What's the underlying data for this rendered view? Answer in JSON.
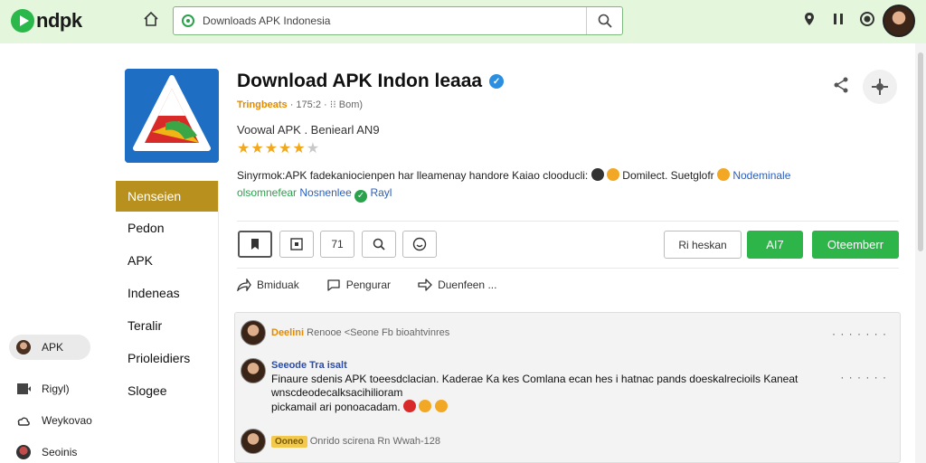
{
  "header": {
    "logo_text": "ndpk",
    "search_value": "Downloads APK Indonesia",
    "icons": [
      "home-icon",
      "location-icon",
      "pause-icon",
      "record-icon"
    ]
  },
  "left_nav": [
    {
      "label": "APK",
      "icon": "avatar-icon",
      "active": true
    },
    {
      "label": "Rigyl)",
      "icon": "play-icon",
      "active": false
    },
    {
      "label": "Weykovao",
      "icon": "cloud-icon",
      "active": false
    },
    {
      "label": "Seoinis",
      "icon": "user-icon",
      "active": false
    }
  ],
  "category_nav": [
    "Nenseien",
    "Pedon",
    "APK",
    "Indeneas",
    "Teralir",
    "Prioleidiers",
    "Slogee"
  ],
  "app": {
    "title": "Download APK Indon leaaa",
    "developer": "Tringbeats",
    "meta": "· 175:2 · ⁝⁝ Bom)",
    "subtitle": "Voowal APK . Beniearl AN9",
    "rating": 4,
    "stars_full": "★★★★★",
    "stars_dim": "★",
    "desc_line1": "Sinyrmok:APK fadekaniocienpen har lleamenay handore Kaiao clooducli:",
    "desc_tail1": "Domilect. Suetglofr",
    "desc_link1": "Nodeminale",
    "desc_green": "olsomnefear",
    "desc_link2": "Nosnenlee",
    "desc_link3": "Rayl"
  },
  "toolbar": {
    "btn_ratings": "71",
    "btn_outline": "Ri heskan",
    "btn_install": "AI7",
    "btn_open": "Oteemberr"
  },
  "actions": [
    {
      "label": "Bmiduak",
      "icon": "share-icon"
    },
    {
      "label": "Pengurar",
      "icon": "comment-icon"
    },
    {
      "label": "Duenfeen ...",
      "icon": "forward-icon"
    }
  ],
  "comments": [
    {
      "name": "Deelini",
      "meta": "Renooe <Seone Fb bioahtvinres",
      "body": "",
      "more": "· · ·  · · · ·"
    },
    {
      "name": "Seeode Tra isalt",
      "meta": "",
      "body_lines": [
        "Finaure sdenis APK toeesdclacian. Kaderae Ka kes Comlana ecan hes i hatnac pands doeskalrecioils Kaneat",
        "wnscdeodecalksacihilioram",
        "pickamail ari ponoacadam."
      ],
      "more": "· ·  · · · ·"
    },
    {
      "name": "Ooneo",
      "meta": "Onrido scirena Rn Wwah-128",
      "body": "",
      "more": ""
    }
  ]
}
